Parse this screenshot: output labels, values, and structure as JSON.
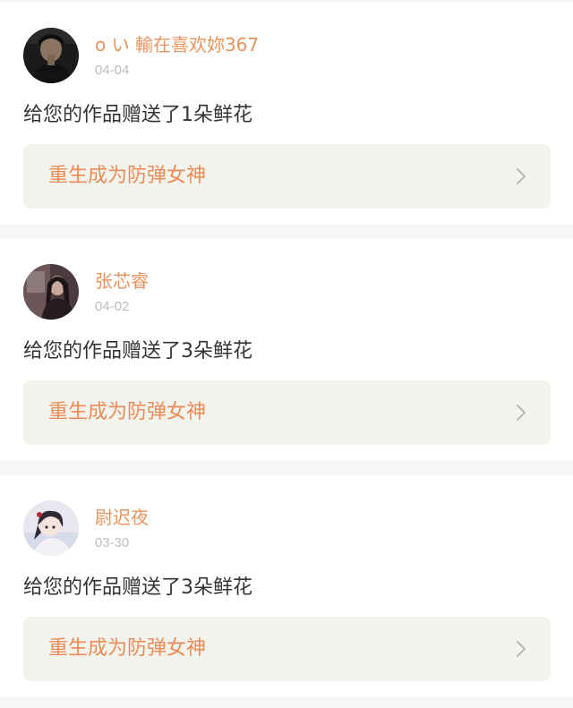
{
  "notifications": [
    {
      "username": "o い 輸在喜欢妳367",
      "date": "04-04",
      "message": "给您的作品赠送了1朵鲜花",
      "book_title": "重生成为防弹女神",
      "avatar": "avatar-dark-portrait"
    },
    {
      "username": "张芯睿",
      "date": "04-02",
      "message": "给您的作品赠送了3朵鲜花",
      "book_title": "重生成为防弹女神",
      "avatar": "avatar-girl-dim-room"
    },
    {
      "username": "尉迟夜",
      "date": "03-30",
      "message": "给您的作品赠送了3朵鲜花",
      "book_title": "重生成为防弹女神",
      "avatar": "avatar-anime-girl"
    }
  ],
  "icons": {
    "chevron": "chevron-right-icon"
  },
  "colors": {
    "username": "#e8945c",
    "book_title": "#ec8b55",
    "date": "#bdbdbd",
    "message": "#333333",
    "link_background": "#f3f3ee",
    "page_background": "#f6f6f6"
  }
}
